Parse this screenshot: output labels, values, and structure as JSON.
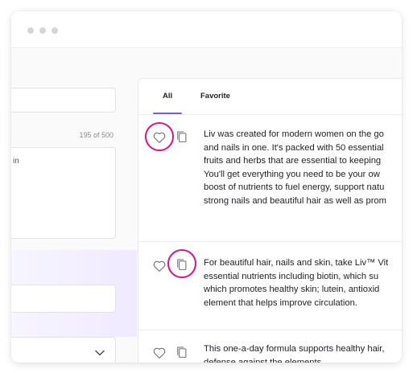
{
  "window": {
    "controls": [
      "close",
      "minimize",
      "zoom"
    ]
  },
  "left_panel": {
    "char_counter": "195 of 500",
    "textarea_fragment": "in",
    "dropdown_icon": "chevron-down-icon"
  },
  "results": {
    "tabs": [
      {
        "label": "All",
        "active": true
      },
      {
        "label": "Favorite",
        "active": false
      }
    ],
    "items": [
      {
        "lines": [
          "Liv was created for modern women on the go",
          "and nails in one. It's packed with 50 essential",
          "fruits and herbs that are essential to keeping",
          "You'll get everything you need to be your ow",
          "boost of nutrients to fuel energy, support natu",
          "strong nails and beautiful hair as well as prom"
        ],
        "highlight": "favorite"
      },
      {
        "lines": [
          "For beautiful hair, nails and skin, take Liv™ Vit",
          "essential nutrients including biotin, which su",
          "which promotes healthy skin; lutein, antioxid",
          "element that helps improve circulation."
        ],
        "highlight": "copy"
      },
      {
        "lines": [
          "This one-a-day formula supports healthy hair,",
          "defense against the elements."
        ],
        "highlight": "none"
      }
    ],
    "icons": {
      "favorite": "heart-icon",
      "copy": "copy-icon"
    }
  },
  "colors": {
    "accent": "#7b5ce6",
    "highlight_ring": "#d4148c"
  }
}
